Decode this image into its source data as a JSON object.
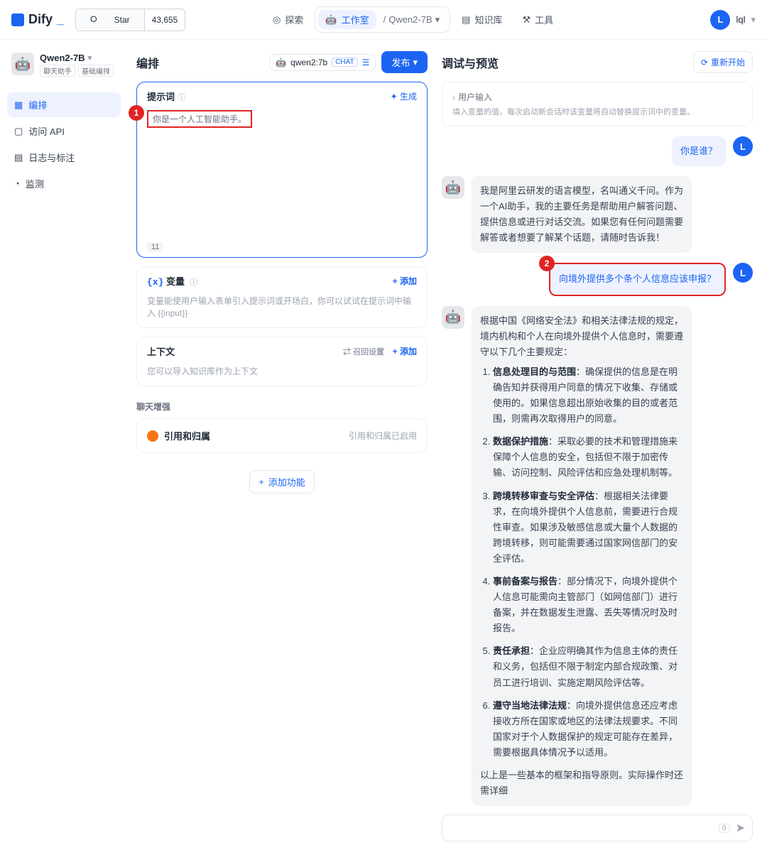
{
  "brand": "Dify",
  "github": {
    "star_label": "Star",
    "count": "43,655"
  },
  "topnav": {
    "explore": "探索",
    "studio": "工作室",
    "crumb": "Qwen2-7B",
    "knowledge": "知识库",
    "tools": "工具"
  },
  "user": {
    "initial": "L",
    "name": "lql"
  },
  "app": {
    "name": "Qwen2-7B",
    "tag1": "聊天助手",
    "tag2": "基础编排"
  },
  "side": {
    "orchestrate": "编排",
    "api": "访问 API",
    "logs": "日志与标注",
    "monitor": "监测"
  },
  "page": {
    "title": "编排",
    "model_name": "qwen2:7b",
    "model_badge": "CHAT",
    "publish": "发布"
  },
  "prompt": {
    "header": "提示词",
    "generate": "生成",
    "value": "你是一个人工智能助手。",
    "count": "11"
  },
  "vars": {
    "header": "变量",
    "add": "添加",
    "desc": "变量能使用户输入表单引入提示词或开场白，你可以试试在提示词中输入 {{input}}"
  },
  "ctx": {
    "header": "上下文",
    "recall": "召回设置",
    "add": "添加",
    "desc": "您可以导入知识库作为上下文"
  },
  "enhance_label": "聊天增强",
  "cite": {
    "label": "引用和归属",
    "status": "引用和归属已启用"
  },
  "add_feature": "添加功能",
  "preview": {
    "title": "调试与预览",
    "restart": "重新开始",
    "user_input_h": "用户输入",
    "user_input_desc": "填入变量的值，每次启动新会话时该变量将自动替换提示词中的变量。"
  },
  "chat": {
    "u1": "你是谁？",
    "a1": "我是阿里云研发的语言模型，名叫通义千问。作为一个AI助手，我的主要任务是帮助用户解答问题、提供信息或进行对话交流。如果您有任何问题需要解答或者想要了解某个话题，请随时告诉我！",
    "u2": "向境外提供多个条个人信息应该申报？",
    "a2_intro": "根据中国《网络安全法》和相关法律法规的规定，境内机构和个人在向境外提供个人信息时，需要遵守以下几个主要规定：",
    "a2_items": [
      {
        "t": "信息处理目的与范围",
        "b": "：确保提供的信息是在明确告知并获得用户同意的情况下收集、存储或使用的。如果信息超出原始收集的目的或者范围，则需再次取得用户的同意。"
      },
      {
        "t": "数据保护措施",
        "b": "：采取必要的技术和管理措施来保障个人信息的安全，包括但不限于加密传输、访问控制、风险评估和应急处理机制等。"
      },
      {
        "t": "跨境转移审查与安全评估",
        "b": "：根据相关法律要求，在向境外提供个人信息前，需要进行合规性审查。如果涉及敏感信息或大量个人数据的跨境转移，则可能需要通过国家网信部门的安全评估。"
      },
      {
        "t": "事前备案与报告",
        "b": "：部分情况下，向境外提供个人信息可能需向主管部门（如网信部门）进行备案，并在数据发生泄露、丢失等情况时及时报告。"
      },
      {
        "t": "责任承担",
        "b": "：企业应明确其作为信息主体的责任和义务，包括但不限于制定内部合规政策、对员工进行培训、实施定期风险评估等。"
      },
      {
        "t": "遵守当地法律法规",
        "b": "：向境外提供信息还应考虑接收方所在国家或地区的法律法规要求。不同国家对于个人数据保护的规定可能存在差异，需要根据具体情况予以适用。"
      }
    ],
    "a2_outro": "以上是一些基本的框架和指导原则。实际操作时还需详细"
  },
  "input_bar": {
    "kbd": "0"
  },
  "annot": {
    "n1": "1",
    "n2": "2"
  }
}
